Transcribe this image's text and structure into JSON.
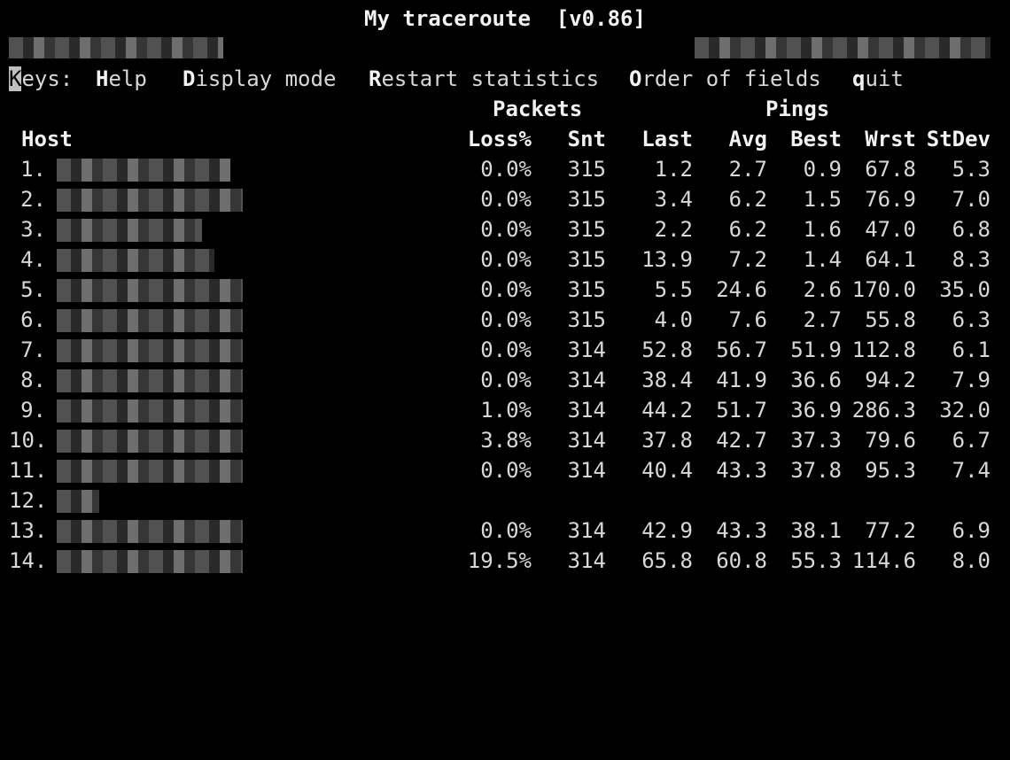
{
  "title": "My traceroute  [v0.86]",
  "keys": {
    "label": "Keys:",
    "items": [
      {
        "hot": "H",
        "rest": "elp"
      },
      {
        "hot": "D",
        "rest": "isplay mode"
      },
      {
        "hot": "R",
        "rest": "estart statistics"
      },
      {
        "hot": "O",
        "rest": "rder of fields"
      },
      {
        "hot": "q",
        "rest": "uit"
      }
    ]
  },
  "headers": {
    "group_packets": "Packets",
    "group_pings": "Pings",
    "host": "Host",
    "loss": "Loss%",
    "snt": "Snt",
    "last": "Last",
    "avg": "Avg",
    "best": "Best",
    "wrst": "Wrst",
    "stdev": "StDev"
  },
  "hops": [
    {
      "n": "1.",
      "loss": "0.0%",
      "snt": "315",
      "last": "1.2",
      "avg": "2.7",
      "best": "0.9",
      "wrst": "67.8",
      "stdev": "5.3"
    },
    {
      "n": "2.",
      "loss": "0.0%",
      "snt": "315",
      "last": "3.4",
      "avg": "6.2",
      "best": "1.5",
      "wrst": "76.9",
      "stdev": "7.0"
    },
    {
      "n": "3.",
      "loss": "0.0%",
      "snt": "315",
      "last": "2.2",
      "avg": "6.2",
      "best": "1.6",
      "wrst": "47.0",
      "stdev": "6.8"
    },
    {
      "n": "4.",
      "loss": "0.0%",
      "snt": "315",
      "last": "13.9",
      "avg": "7.2",
      "best": "1.4",
      "wrst": "64.1",
      "stdev": "8.3"
    },
    {
      "n": "5.",
      "loss": "0.0%",
      "snt": "315",
      "last": "5.5",
      "avg": "24.6",
      "best": "2.6",
      "wrst": "170.0",
      "stdev": "35.0"
    },
    {
      "n": "6.",
      "loss": "0.0%",
      "snt": "315",
      "last": "4.0",
      "avg": "7.6",
      "best": "2.7",
      "wrst": "55.8",
      "stdev": "6.3"
    },
    {
      "n": "7.",
      "loss": "0.0%",
      "snt": "314",
      "last": "52.8",
      "avg": "56.7",
      "best": "51.9",
      "wrst": "112.8",
      "stdev": "6.1"
    },
    {
      "n": "8.",
      "loss": "0.0%",
      "snt": "314",
      "last": "38.4",
      "avg": "41.9",
      "best": "36.6",
      "wrst": "94.2",
      "stdev": "7.9"
    },
    {
      "n": "9.",
      "loss": "1.0%",
      "snt": "314",
      "last": "44.2",
      "avg": "51.7",
      "best": "36.9",
      "wrst": "286.3",
      "stdev": "32.0"
    },
    {
      "n": "10.",
      "loss": "3.8%",
      "snt": "314",
      "last": "37.8",
      "avg": "42.7",
      "best": "37.3",
      "wrst": "79.6",
      "stdev": "6.7"
    },
    {
      "n": "11.",
      "loss": "0.0%",
      "snt": "314",
      "last": "40.4",
      "avg": "43.3",
      "best": "37.8",
      "wrst": "95.3",
      "stdev": "7.4"
    },
    {
      "n": "12.",
      "loss": "",
      "snt": "",
      "last": "",
      "avg": "",
      "best": "",
      "wrst": "",
      "stdev": ""
    },
    {
      "n": "13.",
      "loss": "0.0%",
      "snt": "314",
      "last": "42.9",
      "avg": "43.3",
      "best": "38.1",
      "wrst": "77.2",
      "stdev": "6.9"
    },
    {
      "n": "14.",
      "loss": "19.5%",
      "snt": "314",
      "last": "65.8",
      "avg": "60.8",
      "best": "55.3",
      "wrst": "114.6",
      "stdev": "8.0"
    }
  ]
}
